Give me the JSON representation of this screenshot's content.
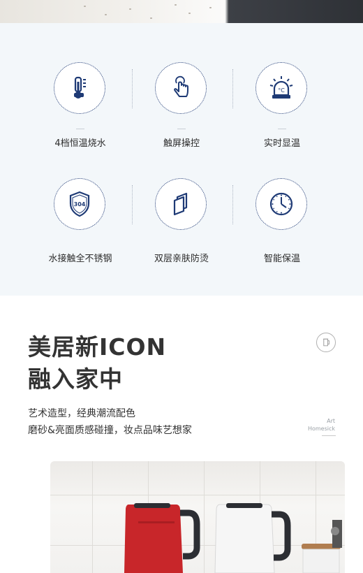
{
  "features": [
    {
      "label": "4档恒温烧水",
      "icon": "thermometer-icon"
    },
    {
      "label": "触屏操控",
      "icon": "touch-hand-icon"
    },
    {
      "label": "实时显温",
      "icon": "celsius-alarm-icon"
    },
    {
      "label": "水接触全不锈钢",
      "icon": "shield-304-icon",
      "icon_text": "304"
    },
    {
      "label": "双层亲肤防烫",
      "icon": "double-layer-icon"
    },
    {
      "label": "智能保温",
      "icon": "clock-icon"
    }
  ],
  "section": {
    "title_line1": "美居新ICON",
    "title_line2": "融入家中",
    "desc_line1": "艺术造型，经典潮流配色",
    "desc_line2": "磨砂&亮面质感碰撞，妆点品味艺想家",
    "brand_line1": "Art",
    "brand_line2": "Homesick"
  },
  "colors": {
    "icon_navy": "#1e3a75",
    "panel_bg": "#f3f7fa",
    "kettle_red": "#c8262a",
    "kettle_white": "#f6f6f6"
  }
}
